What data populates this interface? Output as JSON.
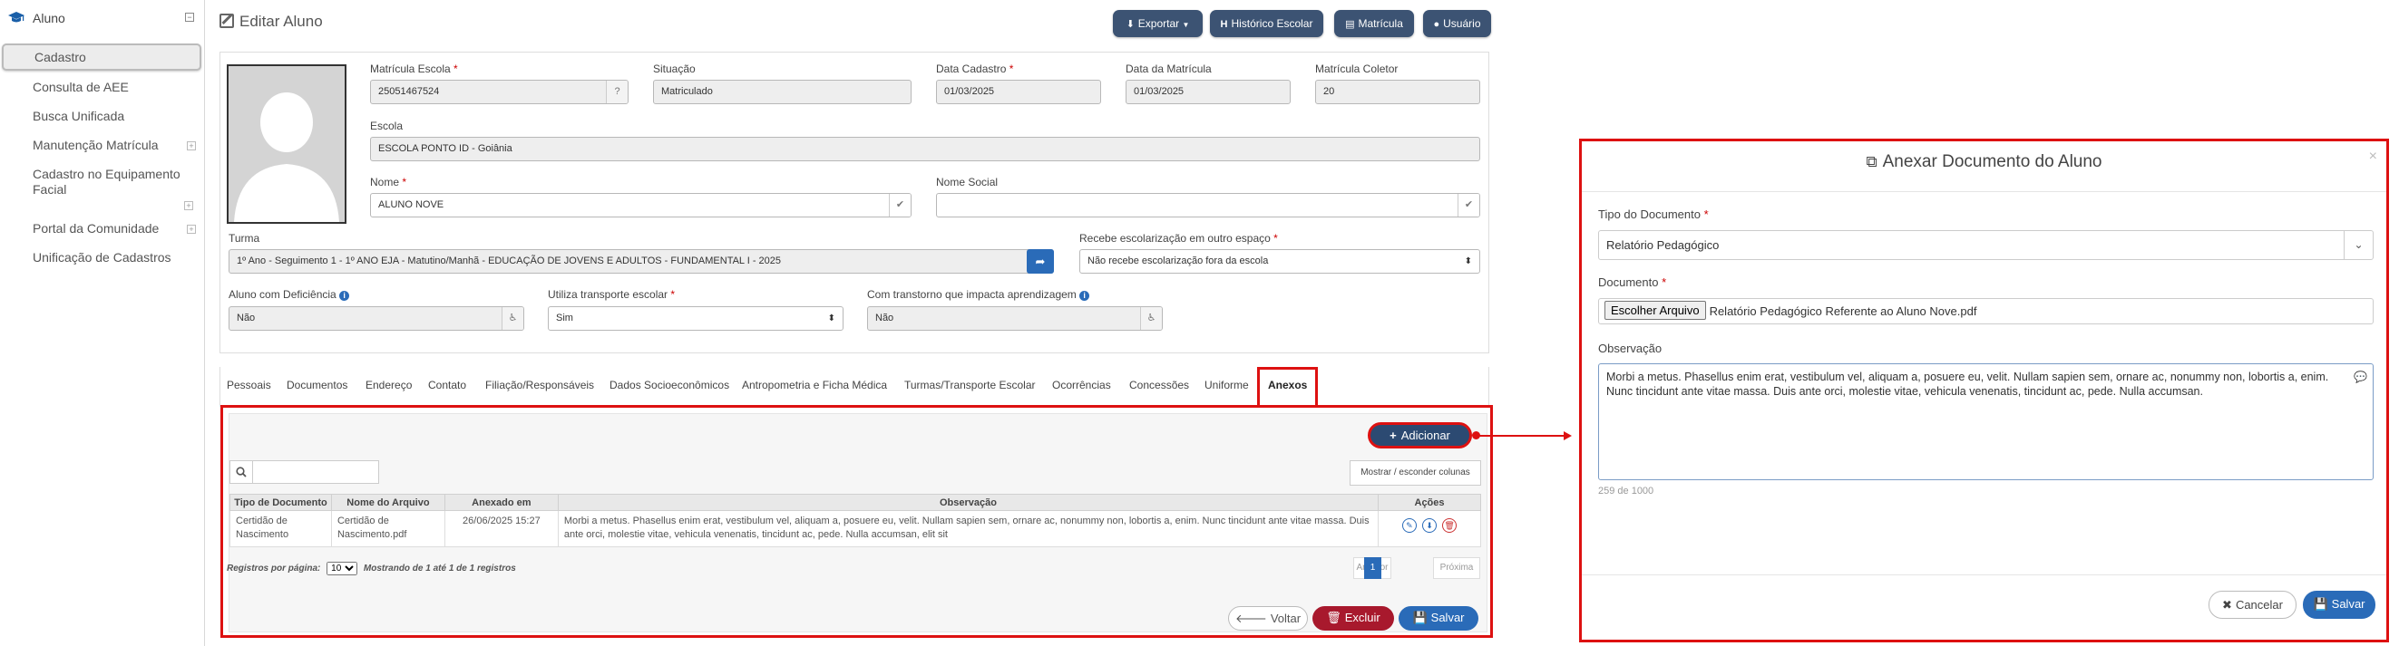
{
  "sidebar": {
    "section_title": "Aluno",
    "items": [
      {
        "label": "Cadastro"
      },
      {
        "label": "Consulta de AEE"
      },
      {
        "label": "Busca Unificada"
      },
      {
        "label": "Manutenção Matrícula"
      },
      {
        "label": "Cadastro no Equipamento Facial"
      },
      {
        "label": "Portal da Comunidade"
      },
      {
        "label": "Unificação de Cadastros"
      }
    ]
  },
  "page": {
    "title": "Editar Aluno",
    "buttons": {
      "exportar": "Exportar",
      "historico": "Histórico Escolar",
      "matricula": "Matrícula",
      "usuario": "Usuário"
    }
  },
  "form": {
    "matricula_escola": {
      "label": "Matrícula Escola",
      "value": "25051467524"
    },
    "situacao": {
      "label": "Situação",
      "value": "Matriculado"
    },
    "data_cadastro": {
      "label": "Data Cadastro",
      "value": "01/03/2025"
    },
    "data_matricula": {
      "label": "Data da Matrícula",
      "value": "01/03/2025"
    },
    "matricula_coletor": {
      "label": "Matrícula Coletor",
      "value": "20"
    },
    "escola": {
      "label": "Escola",
      "value": "ESCOLA PONTO ID - Goiânia"
    },
    "nome": {
      "label": "Nome",
      "value": "ALUNO NOVE"
    },
    "nome_social": {
      "label": "Nome Social",
      "value": ""
    },
    "turma": {
      "label": "Turma",
      "value": "1º Ano - Seguimento 1 - 1º ANO EJA - Matutino/Manhã - EDUCAÇÃO DE JOVENS E ADULTOS - FUNDAMENTAL I - 2025"
    },
    "recebe_escolarizacao": {
      "label": "Recebe escolarização em outro espaço",
      "value": "Não recebe escolarização fora da escola"
    },
    "deficiencia": {
      "label": "Aluno com Deficiência",
      "value": "Não"
    },
    "transporte": {
      "label": "Utiliza transporte escolar",
      "value": "Sim"
    },
    "transtorno": {
      "label": "Com transtorno que impacta aprendizagem",
      "value": "Não"
    }
  },
  "tabs": [
    "Pessoais",
    "Documentos",
    "Endereço",
    "Contato",
    "Filiação/Responsáveis",
    "Dados Socioeconômicos",
    "Antropometria e Ficha Médica",
    "Turmas/Transporte Escolar",
    "Ocorrências",
    "Concessões",
    "Uniforme",
    "Anexos"
  ],
  "anexos": {
    "add_button": "Adicionar",
    "search_placeholder": "",
    "toggle_columns": "Mostrar / esconder colunas",
    "columns": [
      "Tipo de Documento",
      "Nome do Arquivo",
      "Anexado em",
      "Observação",
      "Ações"
    ],
    "rows": [
      {
        "tipo": "Certidão de Nascimento",
        "arquivo": "Certidão de Nascimento.pdf",
        "anexado": "26/06/2025 15:27",
        "observacao": "Morbi a metus. Phasellus enim erat, vestibulum vel, aliquam a, posuere eu, velit. Nullam sapien sem, ornare ac, nonummy non, lobortis a, enim. Nunc tincidunt ante vitae massa. Duis ante orci, molestie vitae, vehicula venenatis, tincidunt ac, pede. Nulla accumsan, elit sit"
      }
    ],
    "page_size_label": "Registros por página:",
    "page_size": "10",
    "info": "Mostrando de 1 até 1 de 1 registros",
    "prev": "Anterior",
    "current_page": "1",
    "next": "Próxima",
    "voltar": "Voltar",
    "excluir": "Excluir",
    "salvar": "Salvar"
  },
  "modal": {
    "title": "Anexar Documento do Aluno",
    "tipo_label": "Tipo do Documento",
    "tipo_value": "Relatório Pedagógico",
    "documento_label": "Documento",
    "file_button": "Escolher Arquivo",
    "file_name": "Relatório Pedagógico Referente ao Aluno Nove.pdf",
    "observacao_label": "Observação",
    "observacao_value": "Morbi a metus. Phasellus enim erat, vestibulum vel, aliquam a, posuere eu, velit. Nullam sapien sem, ornare ac, nonummy non, lobortis a, enim. Nunc tincidunt ante vitae massa. Duis ante orci, molestie vitae, vehicula venenatis, tincidunt ac, pede. Nulla accumsan.",
    "char_count": "259 de 1000",
    "cancel": "Cancelar",
    "save": "Salvar"
  },
  "colors": {
    "primary": "#3c5373",
    "accent_blue": "#2a6bb8",
    "danger": "#a8192d",
    "highlight": "#dd1111"
  }
}
